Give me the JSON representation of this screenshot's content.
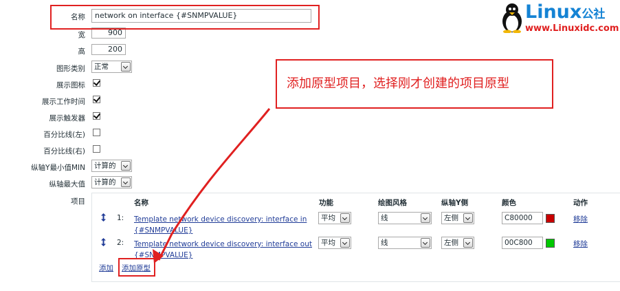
{
  "form": {
    "name_label": "名称",
    "name_value": "network on interface {#SNMPVALUE}",
    "width_label": "宽",
    "width_value": "900",
    "height_label": "高",
    "height_value": "200",
    "graph_type_label": "图形类别",
    "graph_type_value": "正常",
    "show_legend_label": "展示图标",
    "show_working_time_label": "展示工作时间",
    "show_triggers_label": "展示触发器",
    "percentile_left_label": "百分比线(左)",
    "percentile_right_label": "百分比线(右)",
    "ymin_label": "纵轴Y最小值MIN",
    "ymin_value": "计算的",
    "ymax_label": "纵轴最大值",
    "ymax_value": "计算的",
    "items_label": "项目"
  },
  "items_table": {
    "headers": {
      "name": "名称",
      "function": "功能",
      "style": "绘图风格",
      "axis": "纵轴Y侧",
      "color": "颜色",
      "action": "动作"
    },
    "rows": [
      {
        "index": "1:",
        "name_line1": "Template network device discovery: interface in",
        "name_line2": "{#SNMPVALUE}",
        "function": "平均",
        "style": "线",
        "axis": "左侧",
        "color": "C80000",
        "color_hex": "#C80000",
        "action": "移除"
      },
      {
        "index": "2:",
        "name_line1": "Template network device discovery: interface out",
        "name_line2": "{#SNMPVALUE}",
        "function": "平均",
        "style": "线",
        "axis": "左侧",
        "color": "00C800",
        "color_hex": "#00C800",
        "action": "移除"
      }
    ],
    "add_link": "添加",
    "add_prototype_link": "添加原型"
  },
  "annotation": {
    "callout_text": "添加原型项目，选择刚才创建的项目原型",
    "accent_color": "#e02020"
  },
  "logo": {
    "brand": "Linux",
    "brand_suffix": "公社",
    "url": "www.Linuxidc.com"
  }
}
